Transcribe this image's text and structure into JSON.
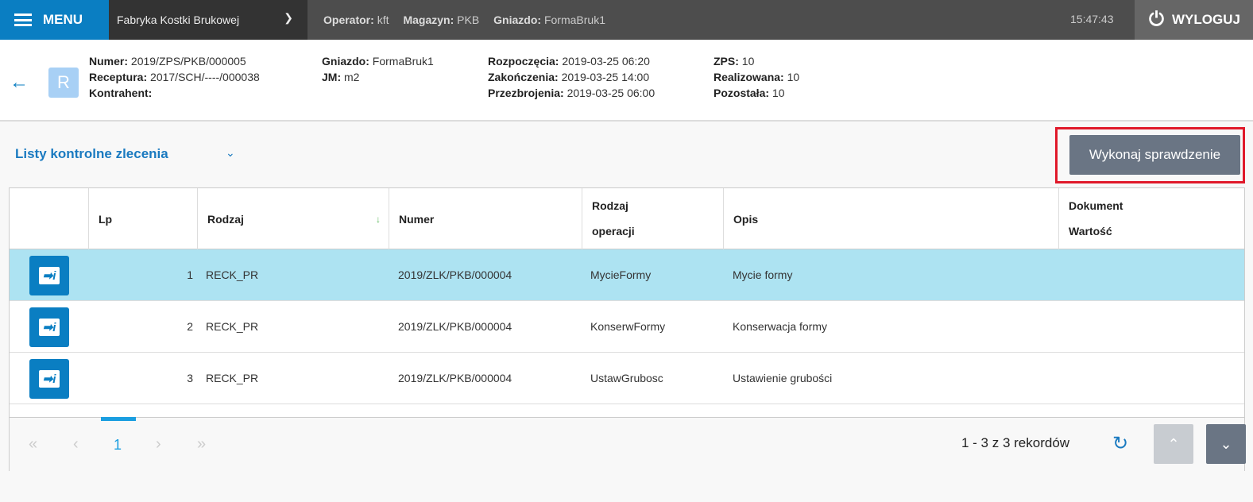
{
  "topbar": {
    "menu_label": "MENU",
    "company": "Fabryka Kostki Brukowej",
    "operator_label": "Operator:",
    "operator": "kft",
    "magazyn_label": "Magazyn:",
    "magazyn": "PKB",
    "gniazdo_label": "Gniazdo:",
    "gniazdo": "FormaBruk1",
    "clock": "15:47:43",
    "logout_label": "WYLOGUJ"
  },
  "info": {
    "avatar_letter": "R",
    "numer_label": "Numer:",
    "numer": "2019/ZPS/PKB/000005",
    "receptura_label": "Receptura:",
    "receptura": "2017/SCH/----/000038",
    "kontrahent_label": "Kontrahent:",
    "gniazdo_label": "Gniazdo:",
    "gniazdo": "FormaBruk1",
    "jm_label": "JM:",
    "jm": "m2",
    "rozp_label": "Rozpoczęcia:",
    "rozp": "2019-03-25 06:20",
    "zak_label": "Zakończenia:",
    "zak": "2019-03-25 14:00",
    "przez_label": "Przezbrojenia:",
    "przez": "2019-03-25 06:00",
    "zps_label": "ZPS:",
    "zps": "10",
    "real_label": "Realizowana:",
    "real": "10",
    "poz_label": "Pozostała:",
    "poz": "10"
  },
  "toolbar": {
    "title": "Listy kontrolne zlecenia",
    "action": "Wykonaj sprawdzenie"
  },
  "table": {
    "headers": {
      "lp": "Lp",
      "rodzaj": "Rodzaj",
      "numer": "Numer",
      "rodzaj_op_1": "Rodzaj",
      "rodzaj_op_2": "operacji",
      "opis": "Opis",
      "dok_1": "Dokument",
      "dok_2": "Wartość"
    },
    "rows": [
      {
        "lp": "1",
        "rodzaj": "RECK_PR",
        "numer": "2019/ZLK/PKB/000004",
        "operacja": "MycieFormy",
        "opis": "Mycie formy"
      },
      {
        "lp": "2",
        "rodzaj": "RECK_PR",
        "numer": "2019/ZLK/PKB/000004",
        "operacja": "KonserwFormy",
        "opis": "Konserwacja formy"
      },
      {
        "lp": "3",
        "rodzaj": "RECK_PR",
        "numer": "2019/ZLK/PKB/000004",
        "operacja": "UstawGrubosc",
        "opis": "Ustawienie grubości"
      }
    ]
  },
  "pager": {
    "page": "1",
    "records": "1 - 3 z 3 rekordów"
  }
}
